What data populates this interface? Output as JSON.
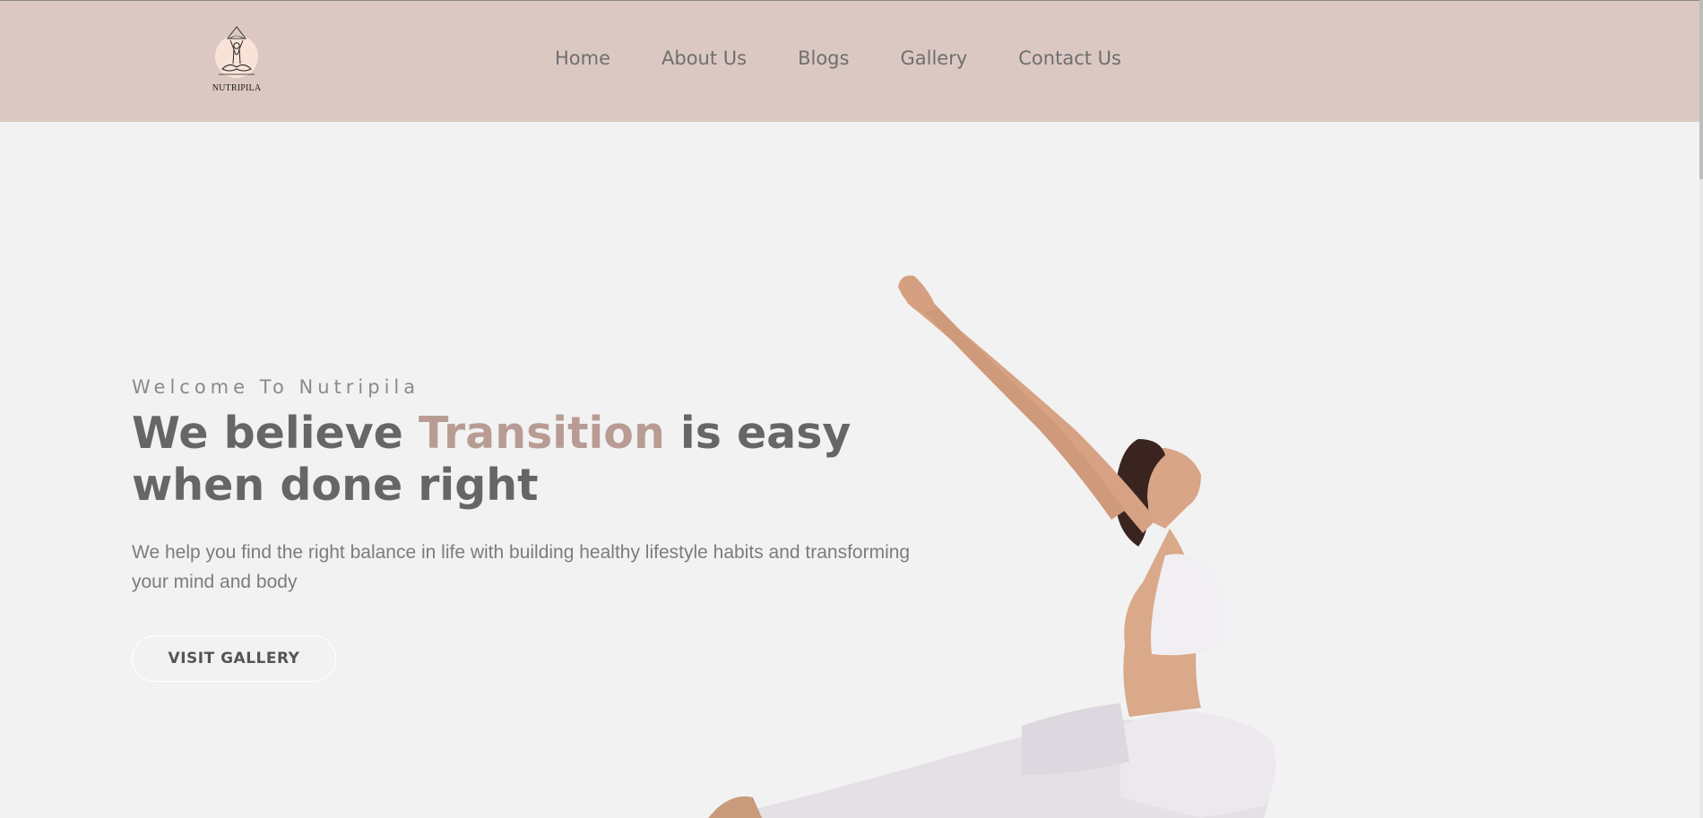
{
  "header": {
    "logo_text": "NUTRIPILA",
    "nav": [
      {
        "label": "Home"
      },
      {
        "label": "About Us"
      },
      {
        "label": "Blogs"
      },
      {
        "label": "Gallery"
      },
      {
        "label": "Contact Us"
      }
    ]
  },
  "hero": {
    "eyebrow": "Welcome To Nutripila",
    "title_before": "We believe ",
    "title_accent": "Transition",
    "title_after": " is easy when done right",
    "description": "We help you find the right balance in life with building healthy lifestyle habits and transforming your mind and body",
    "button_label": "VISIT GALLERY"
  },
  "colors": {
    "header_bg": "#dcc8c2",
    "page_bg": "#f2f2f2",
    "accent": "#b89c94",
    "heading": "#666666",
    "body_text": "#7c7c7c"
  },
  "icons": {
    "logo": "meditation-figure-icon"
  }
}
